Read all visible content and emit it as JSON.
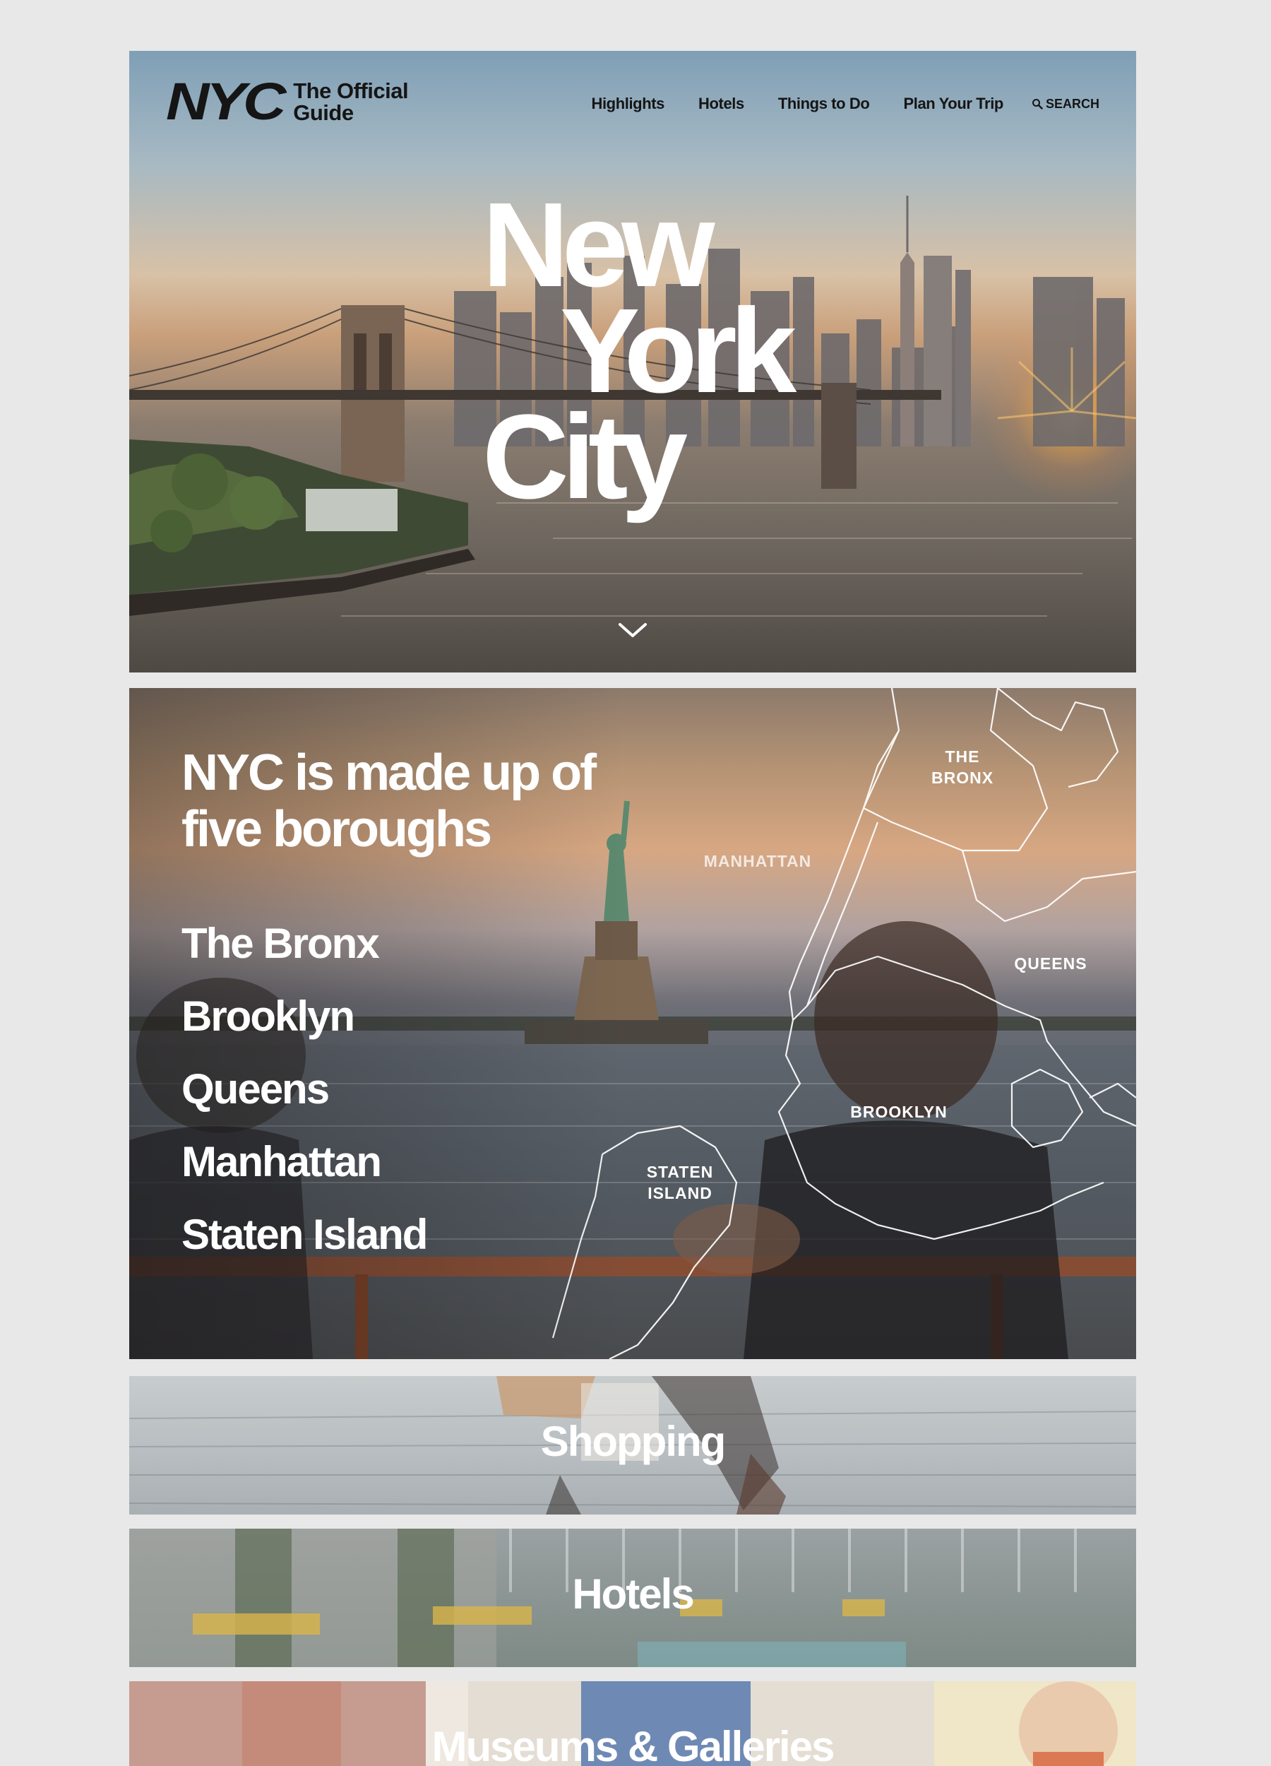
{
  "header": {
    "logo_mark": "NYC",
    "logo_line1": "The Official",
    "logo_line2": "Guide",
    "nav": [
      "Highlights",
      "Hotels",
      "Things to Do",
      "Plan Your Trip"
    ],
    "search_label": "SEARCH"
  },
  "hero": {
    "title_line1": "New",
    "title_line2": "York",
    "title_line3": "City"
  },
  "boroughs": {
    "title_line1": "NYC is made up of",
    "title_line2": "five boroughs",
    "items": [
      "The Bronx",
      "Brooklyn",
      "Queens",
      "Manhattan",
      "Staten Island"
    ],
    "map_labels": {
      "bronx_1": "THE",
      "bronx_2": "BRONX",
      "manhattan": "MANHATTAN",
      "queens": "QUEENS",
      "brooklyn": "BROOKLYN",
      "staten_1": "STATEN",
      "staten_2": "ISLAND"
    }
  },
  "tiles": {
    "shopping": "Shopping",
    "hotels": "Hotels",
    "museums": "Museums & Galleries"
  },
  "colors": {
    "background": "#e8e8e8",
    "text_dark": "#151515",
    "text_light": "#ffffff"
  },
  "icons": {
    "search": "search-icon",
    "chevron": "chevron-down-icon"
  }
}
